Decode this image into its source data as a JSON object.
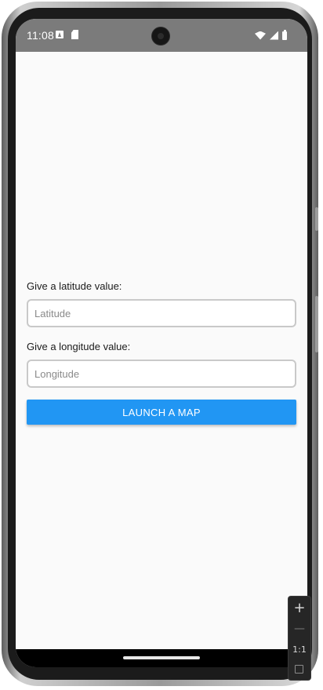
{
  "status_bar": {
    "time": "11:08",
    "icons": [
      "app-a-icon",
      "sd-card-icon",
      "wifi-icon",
      "signal-icon",
      "battery-icon"
    ]
  },
  "form": {
    "latitude_label": "Give a latitude value:",
    "latitude_placeholder": "Latitude",
    "latitude_value": "",
    "longitude_label": "Give a longitude value:",
    "longitude_placeholder": "Longitude",
    "longitude_value": "",
    "launch_button_label": "LAUNCH A MAP"
  },
  "emulator_zoom": {
    "zoom_in_label": "+",
    "zoom_out_label": "—",
    "reset_label": "1:1"
  },
  "colors": {
    "status_bar": "#7b7b7b",
    "background": "#fafafa",
    "button": "#2196f3",
    "button_text": "#ffffff"
  }
}
